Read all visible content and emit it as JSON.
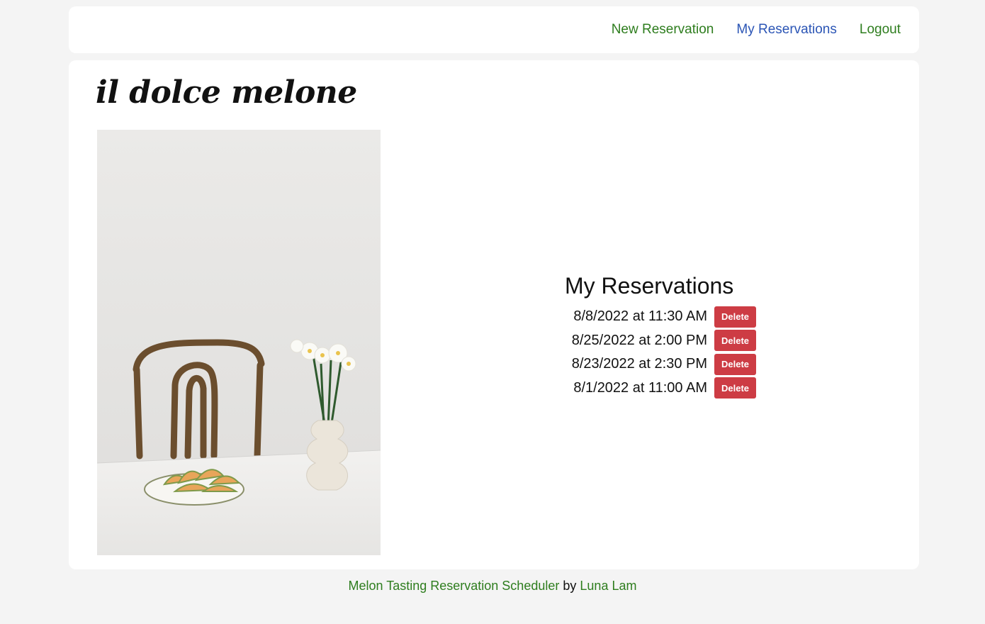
{
  "nav": {
    "items": [
      {
        "label": "New Reservation"
      },
      {
        "label": "My Reservations"
      },
      {
        "label": "Logout"
      }
    ]
  },
  "brand": "il dolce melone",
  "photo": {
    "alt": "Melon slices on a plate next to a vase of white flowers and a wooden chair"
  },
  "reservations": {
    "title": "My Reservations",
    "delete_label": "Delete",
    "items": [
      {
        "text": "8/8/2022 at 11:30 AM"
      },
      {
        "text": "8/25/2022 at 2:00 PM"
      },
      {
        "text": "8/23/2022 at 2:30 PM"
      },
      {
        "text": "8/1/2022 at 11:00 AM"
      }
    ]
  },
  "footer": {
    "app_link": "Melon Tasting Reservation Scheduler",
    "by": "by",
    "author_link": "Luna Lam"
  },
  "colors": {
    "link_green": "#2e7d1e",
    "link_active_blue": "#2b55b5",
    "delete_red": "#cd3c44",
    "background": "#f4f4f4"
  }
}
